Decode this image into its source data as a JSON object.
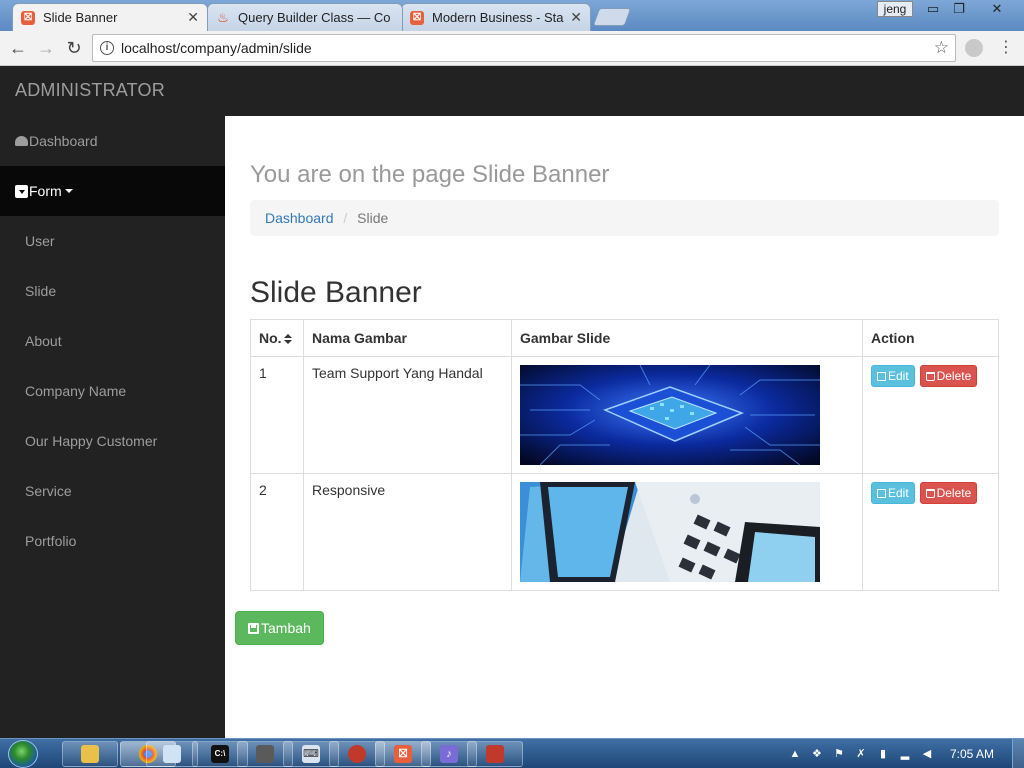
{
  "browser": {
    "tabs": [
      {
        "title": "Slide Banner",
        "active": true
      },
      {
        "title": "Query Builder Class — Co",
        "active": false
      },
      {
        "title": "Modern Business - Start",
        "active": false
      }
    ],
    "user_chip": "jeng",
    "url": "localhost/company/admin/slide"
  },
  "app": {
    "brand": "ADMINISTRATOR",
    "sidebar": {
      "dashboard": "Dashboard",
      "form": "Form",
      "items": [
        {
          "label": "User"
        },
        {
          "label": "Slide"
        },
        {
          "label": "About"
        },
        {
          "label": "Company Name"
        },
        {
          "label": "Our Happy Customer"
        },
        {
          "label": "Service"
        },
        {
          "label": "Portfolio"
        }
      ]
    },
    "page_header": "You are on the page Slide Banner",
    "breadcrumb": {
      "link": "Dashboard",
      "separator": "/",
      "current": "Slide"
    },
    "section_title": "Slide Banner",
    "table": {
      "headers": {
        "no": "No.",
        "name": "Nama Gambar",
        "image": "Gambar Slide",
        "action": "Action"
      },
      "rows": [
        {
          "no": "1",
          "name": "Team Support Yang Handal",
          "image": "circuit-chip-image"
        },
        {
          "no": "2",
          "name": "Responsive",
          "image": "devices-image"
        }
      ],
      "edit_label": "Edit",
      "delete_label": "Delete"
    },
    "add_button": "Tambah"
  },
  "taskbar": {
    "clock": "7:05 AM"
  },
  "colors": {
    "navbar": "#222222",
    "sidebar_active": "#080808",
    "link": "#337ab7",
    "btn_edit": "#5bc0de",
    "btn_delete": "#d9534f",
    "btn_add": "#5cb85c"
  }
}
